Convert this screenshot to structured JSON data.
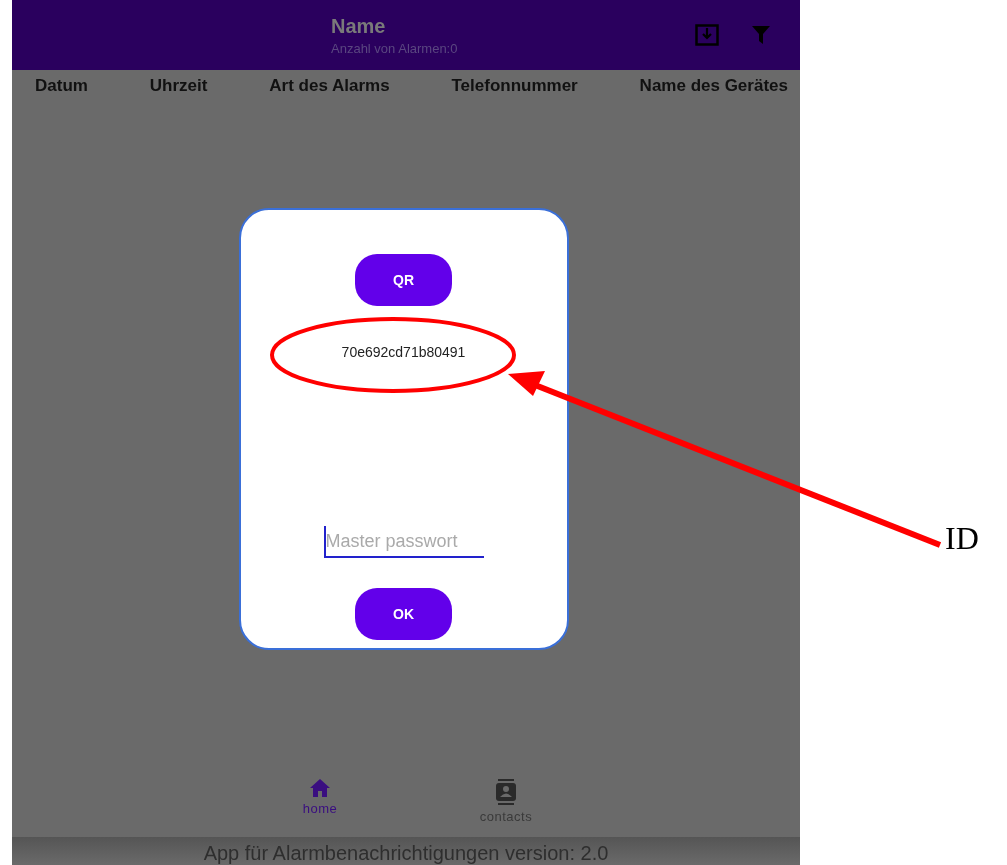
{
  "app_bar": {
    "title": "Name",
    "subtitle": "Anzahl von Alarmen:0"
  },
  "table": {
    "columns": [
      "Datum",
      "Uhrzeit",
      "Art des Alarms",
      "Telefonnummer",
      "Name des Gerätes"
    ]
  },
  "dialog": {
    "qr_button": "QR",
    "device_id": "70e692cd71b80491",
    "password": {
      "placeholder": "Master passwort"
    },
    "ok_button": "OK"
  },
  "bottom_nav": [
    {
      "kind": "home",
      "label": "home",
      "selected": true
    },
    {
      "kind": "contacts",
      "label": "contacts",
      "selected": false
    }
  ],
  "footer": "App für Alarmbenachrichtigungen version: 2.0",
  "annotation": {
    "label": "ID"
  }
}
